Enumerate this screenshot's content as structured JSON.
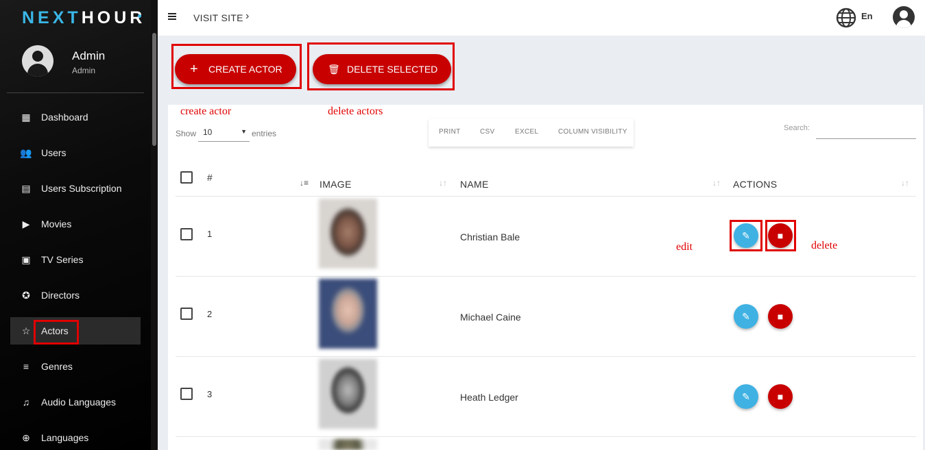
{
  "sidebar": {
    "logo_left": "NEXT",
    "logo_right": "HOUR",
    "user": {
      "name": "Admin",
      "role": "Admin"
    },
    "items": [
      {
        "label": "Dashboard",
        "icon": "dashboard-icon",
        "glyph": "▦"
      },
      {
        "label": "Users",
        "icon": "users-icon",
        "glyph": "👥"
      },
      {
        "label": "Users Subscription",
        "icon": "document-icon",
        "glyph": "▤"
      },
      {
        "label": "Movies",
        "icon": "movie-icon",
        "glyph": "▶"
      },
      {
        "label": "TV Series",
        "icon": "tv-icon",
        "glyph": "▣"
      },
      {
        "label": "Directors",
        "icon": "star-circle-icon",
        "glyph": "✪"
      },
      {
        "label": "Actors",
        "icon": "star-icon",
        "glyph": "☆"
      },
      {
        "label": "Genres",
        "icon": "filter-icon",
        "glyph": "≡"
      },
      {
        "label": "Audio Languages",
        "icon": "music-list-icon",
        "glyph": "♫"
      },
      {
        "label": "Languages",
        "icon": "globe-icon",
        "glyph": "⊕"
      }
    ],
    "active": "Actors"
  },
  "topbar": {
    "visit_site": "VISIT SITE",
    "visit_chevron": "›",
    "lang": "En"
  },
  "actions": {
    "create_label": "CREATE ACTOR",
    "create_icon": "+",
    "delete_label": "DELETE SELECTED",
    "delete_icon": "🗑"
  },
  "annotations": {
    "create": "create actor",
    "delete_actors": "delete actors",
    "edit": "edit",
    "delete": "delete"
  },
  "table_controls": {
    "show": "Show",
    "entries_value": "10",
    "entries": "entries",
    "export_buttons": [
      "PRINT",
      "CSV",
      "EXCEL",
      "COLUMN VISIBILITY"
    ],
    "search_label": "Search:"
  },
  "table": {
    "columns": [
      "#",
      "IMAGE",
      "NAME",
      "ACTIONS"
    ],
    "rows": [
      {
        "num": "1",
        "name": "Christian Bale"
      },
      {
        "num": "2",
        "name": "Michael Caine"
      },
      {
        "num": "3",
        "name": "Heath Ledger"
      }
    ]
  },
  "colors": {
    "accent": "#c80000",
    "edit": "#3fb2e3",
    "annotation": "#e00000",
    "logo_highlight": "#3ab7e6"
  }
}
